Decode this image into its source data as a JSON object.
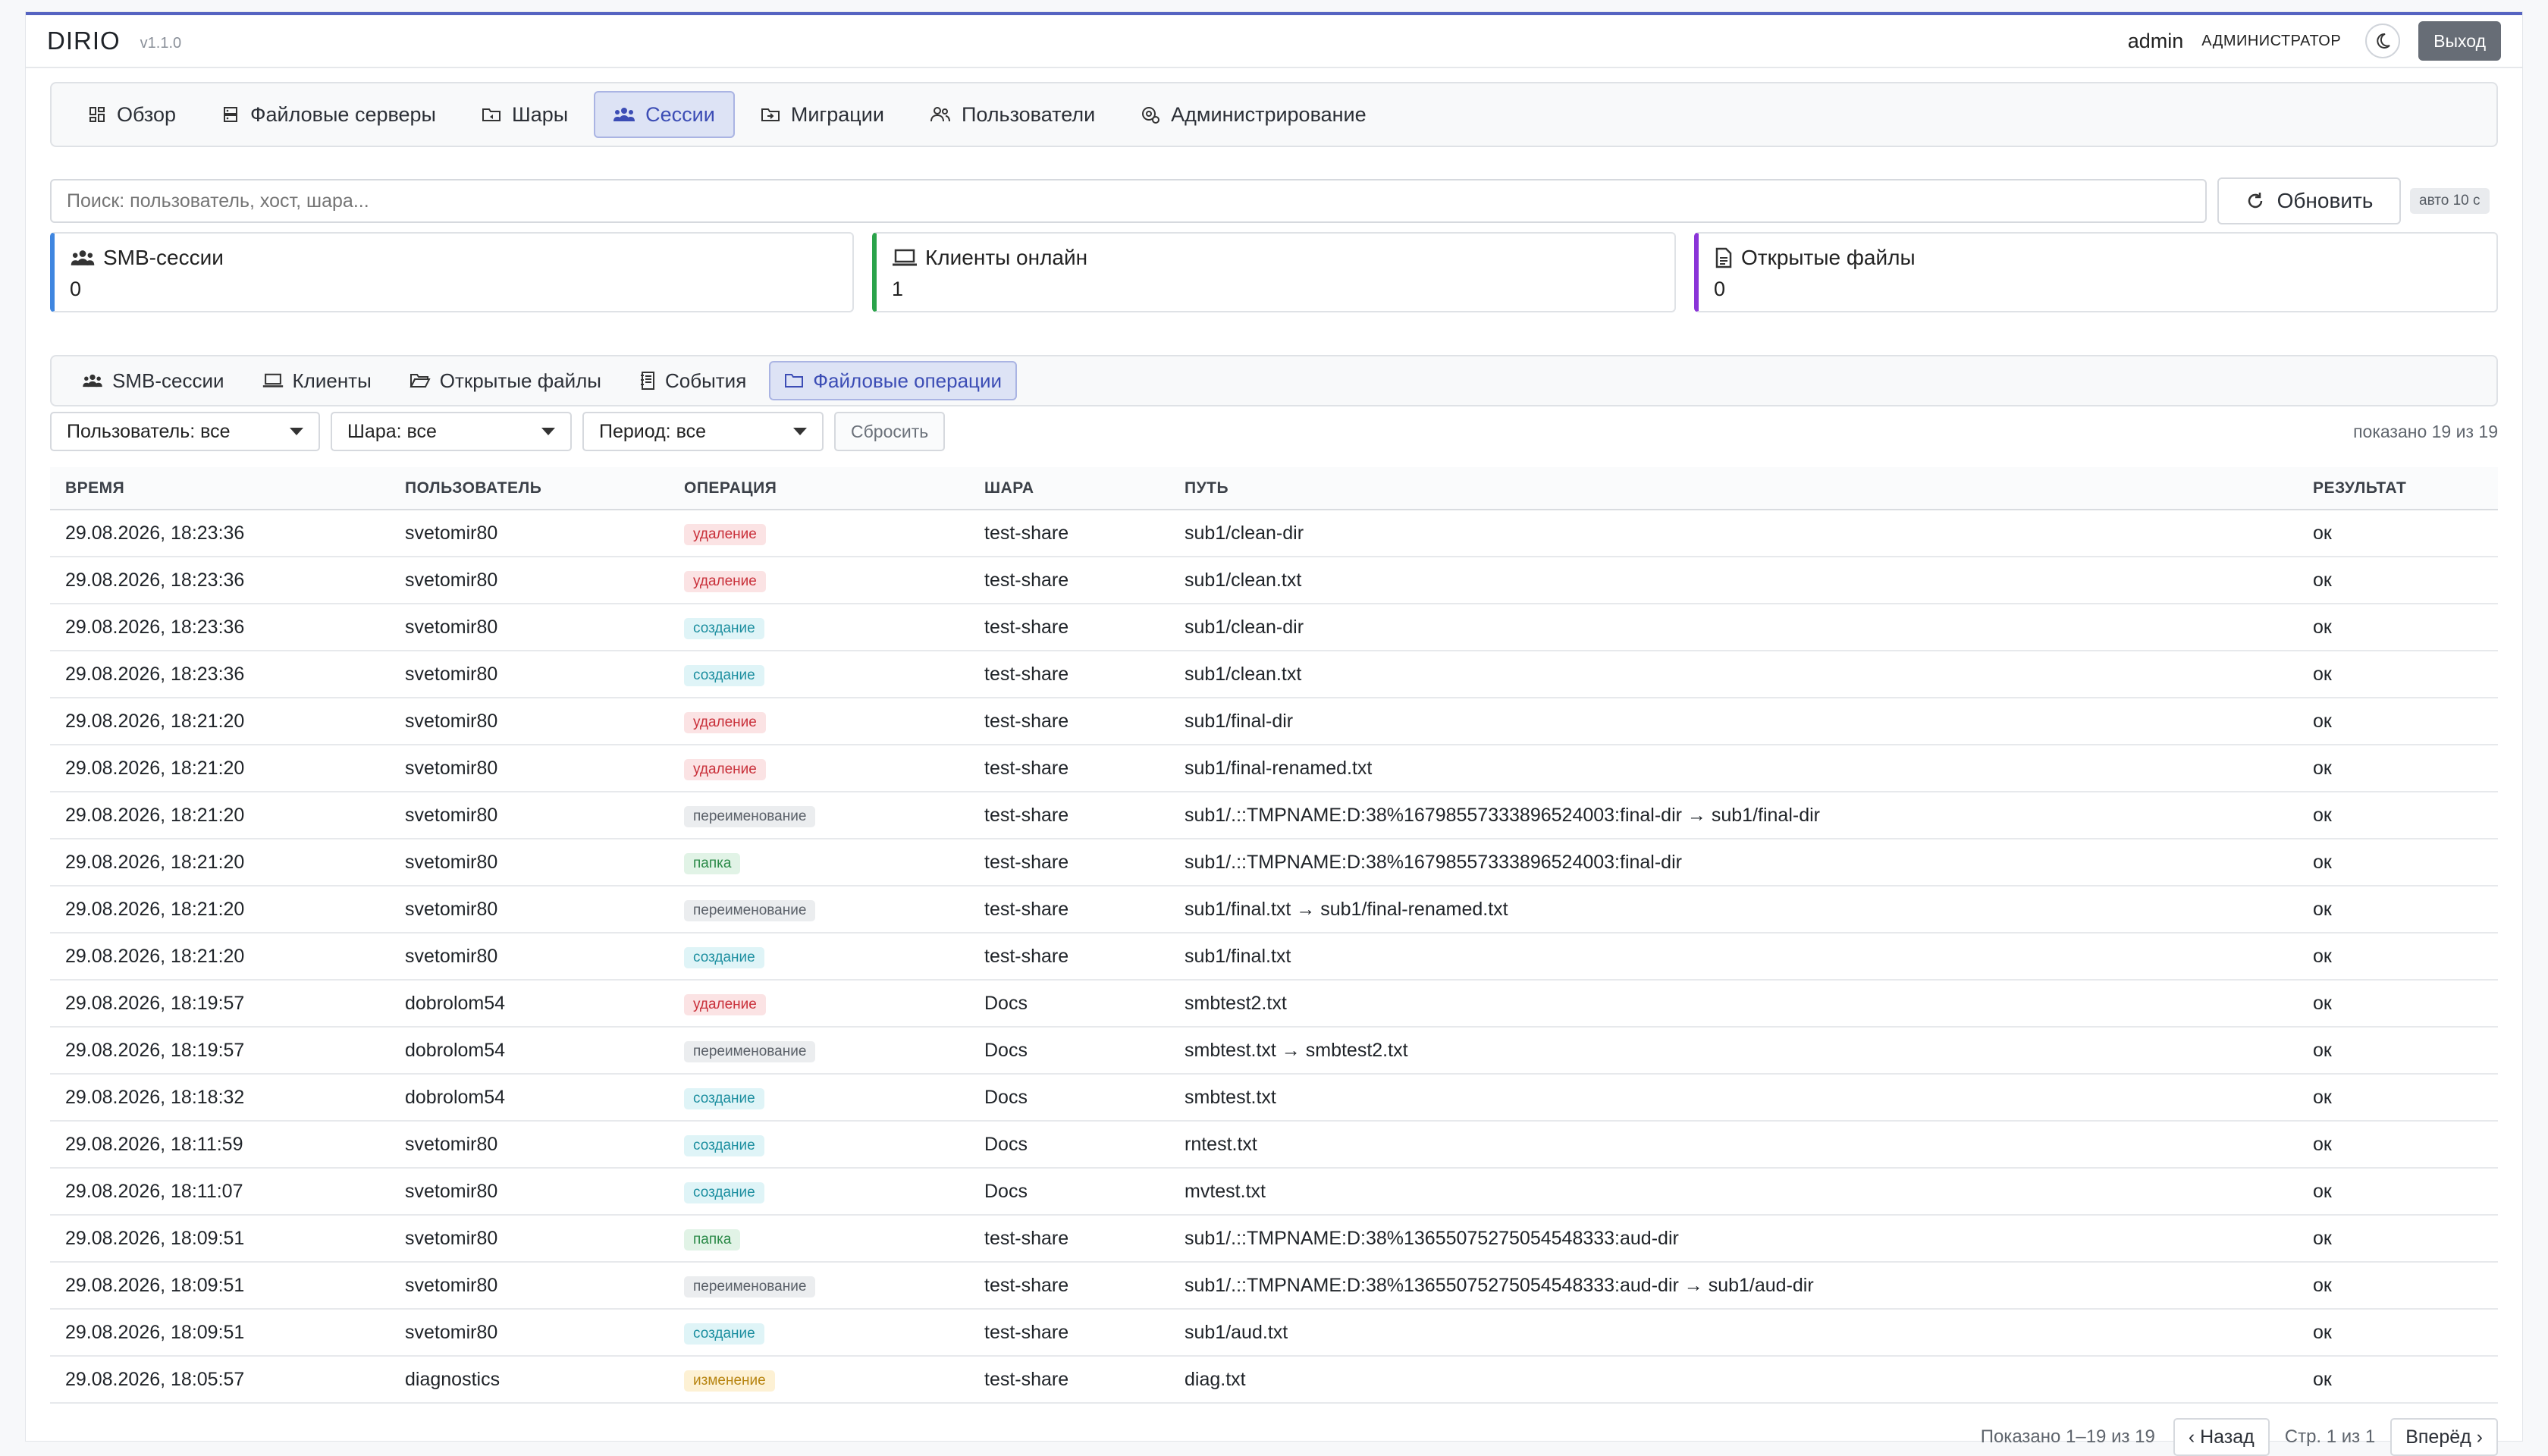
{
  "header": {
    "brand": "DIRIO",
    "version": "v1.1.0",
    "username": "admin",
    "role": "АДМИНИСТРАТОР",
    "logout_label": "Выход"
  },
  "nav": {
    "tabs": [
      {
        "label": "Обзор",
        "icon": "dashboard-icon"
      },
      {
        "label": "Файловые серверы",
        "icon": "server-icon"
      },
      {
        "label": "Шары",
        "icon": "folder-share-icon"
      },
      {
        "label": "Сессии",
        "icon": "users-icon"
      },
      {
        "label": "Миграции",
        "icon": "folder-move-icon"
      },
      {
        "label": "Пользователи",
        "icon": "user-group-icon"
      },
      {
        "label": "Администрирование",
        "icon": "admin-gear-icon"
      }
    ],
    "active": "Сессии"
  },
  "search": {
    "placeholder": "Поиск: пользователь, хост, шара..."
  },
  "refresh": {
    "label": "Обновить",
    "auto_label": "авто 10 с"
  },
  "stats": [
    {
      "label": "SMB-сессии",
      "value": "0",
      "color": "#3f86e0",
      "icon": "users-icon"
    },
    {
      "label": "Клиенты онлайн",
      "value": "1",
      "color": "#2aa34a",
      "icon": "laptop-icon"
    },
    {
      "label": "Открытые файлы",
      "value": "0",
      "color": "#8a34d8",
      "icon": "file-icon"
    }
  ],
  "subtabs": {
    "items": [
      {
        "label": "SMB-сессии",
        "icon": "users-icon"
      },
      {
        "label": "Клиенты",
        "icon": "laptop-icon"
      },
      {
        "label": "Открытые файлы",
        "icon": "folder-open-icon"
      },
      {
        "label": "События",
        "icon": "journal-icon"
      },
      {
        "label": "Файловые операции",
        "icon": "folder-icon"
      }
    ],
    "active": "Файловые операции"
  },
  "filters": {
    "user": "Пользователь: все",
    "share": "Шара: все",
    "period": "Период: все",
    "reset_label": "Сбросить",
    "shown_label": "показано 19 из 19"
  },
  "table": {
    "columns": [
      "ВРЕМЯ",
      "ПОЛЬЗОВАТЕЛЬ",
      "ОПЕРАЦИЯ",
      "ШАРА",
      "ПУТЬ",
      "РЕЗУЛЬТАТ"
    ],
    "rows": [
      {
        "time": "29.08.2026, 18:23:36",
        "user": "svetomir80",
        "op": "удаление",
        "op_type": "del",
        "share": "test-share",
        "path": "sub1/clean-dir",
        "result": "ок"
      },
      {
        "time": "29.08.2026, 18:23:36",
        "user": "svetomir80",
        "op": "удаление",
        "op_type": "del",
        "share": "test-share",
        "path": "sub1/clean.txt",
        "result": "ок"
      },
      {
        "time": "29.08.2026, 18:23:36",
        "user": "svetomir80",
        "op": "создание",
        "op_type": "cre",
        "share": "test-share",
        "path": "sub1/clean-dir",
        "result": "ок"
      },
      {
        "time": "29.08.2026, 18:23:36",
        "user": "svetomir80",
        "op": "создание",
        "op_type": "cre",
        "share": "test-share",
        "path": "sub1/clean.txt",
        "result": "ок"
      },
      {
        "time": "29.08.2026, 18:21:20",
        "user": "svetomir80",
        "op": "удаление",
        "op_type": "del",
        "share": "test-share",
        "path": "sub1/final-dir",
        "result": "ок"
      },
      {
        "time": "29.08.2026, 18:21:20",
        "user": "svetomir80",
        "op": "удаление",
        "op_type": "del",
        "share": "test-share",
        "path": "sub1/final-renamed.txt",
        "result": "ок"
      },
      {
        "time": "29.08.2026, 18:21:20",
        "user": "svetomir80",
        "op": "переименование",
        "op_type": "ren",
        "share": "test-share",
        "path": "sub1/.::TMPNAME:D:38%16798557333896524003:final-dir → sub1/final-dir",
        "result": "ок"
      },
      {
        "time": "29.08.2026, 18:21:20",
        "user": "svetomir80",
        "op": "папка",
        "op_type": "dir",
        "share": "test-share",
        "path": "sub1/.::TMPNAME:D:38%16798557333896524003:final-dir",
        "result": "ок"
      },
      {
        "time": "29.08.2026, 18:21:20",
        "user": "svetomir80",
        "op": "переименование",
        "op_type": "ren",
        "share": "test-share",
        "path": "sub1/final.txt → sub1/final-renamed.txt",
        "result": "ок"
      },
      {
        "time": "29.08.2026, 18:21:20",
        "user": "svetomir80",
        "op": "создание",
        "op_type": "cre",
        "share": "test-share",
        "path": "sub1/final.txt",
        "result": "ок"
      },
      {
        "time": "29.08.2026, 18:19:57",
        "user": "dobrolom54",
        "op": "удаление",
        "op_type": "del",
        "share": "Docs",
        "path": "smbtest2.txt",
        "result": "ок"
      },
      {
        "time": "29.08.2026, 18:19:57",
        "user": "dobrolom54",
        "op": "переименование",
        "op_type": "ren",
        "share": "Docs",
        "path": "smbtest.txt → smbtest2.txt",
        "result": "ок"
      },
      {
        "time": "29.08.2026, 18:18:32",
        "user": "dobrolom54",
        "op": "создание",
        "op_type": "cre",
        "share": "Docs",
        "path": "smbtest.txt",
        "result": "ок"
      },
      {
        "time": "29.08.2026, 18:11:59",
        "user": "svetomir80",
        "op": "создание",
        "op_type": "cre",
        "share": "Docs",
        "path": "rntest.txt",
        "result": "ок"
      },
      {
        "time": "29.08.2026, 18:11:07",
        "user": "svetomir80",
        "op": "создание",
        "op_type": "cre",
        "share": "Docs",
        "path": "mvtest.txt",
        "result": "ок"
      },
      {
        "time": "29.08.2026, 18:09:51",
        "user": "svetomir80",
        "op": "папка",
        "op_type": "dir",
        "share": "test-share",
        "path": "sub1/.::TMPNAME:D:38%13655075275054548333:aud-dir",
        "result": "ок"
      },
      {
        "time": "29.08.2026, 18:09:51",
        "user": "svetomir80",
        "op": "переименование",
        "op_type": "ren",
        "share": "test-share",
        "path": "sub1/.::TMPNAME:D:38%13655075275054548333:aud-dir → sub1/aud-dir",
        "result": "ок"
      },
      {
        "time": "29.08.2026, 18:09:51",
        "user": "svetomir80",
        "op": "создание",
        "op_type": "cre",
        "share": "test-share",
        "path": "sub1/aud.txt",
        "result": "ок"
      },
      {
        "time": "29.08.2026, 18:05:57",
        "user": "diagnostics",
        "op": "изменение",
        "op_type": "mod",
        "share": "test-share",
        "path": "diag.txt",
        "result": "ок"
      }
    ]
  },
  "pager": {
    "info": "Показано 1–19 из 19",
    "prev": "‹ Назад",
    "page": "Стр. 1 из 1",
    "next": "Вперёд ›"
  }
}
